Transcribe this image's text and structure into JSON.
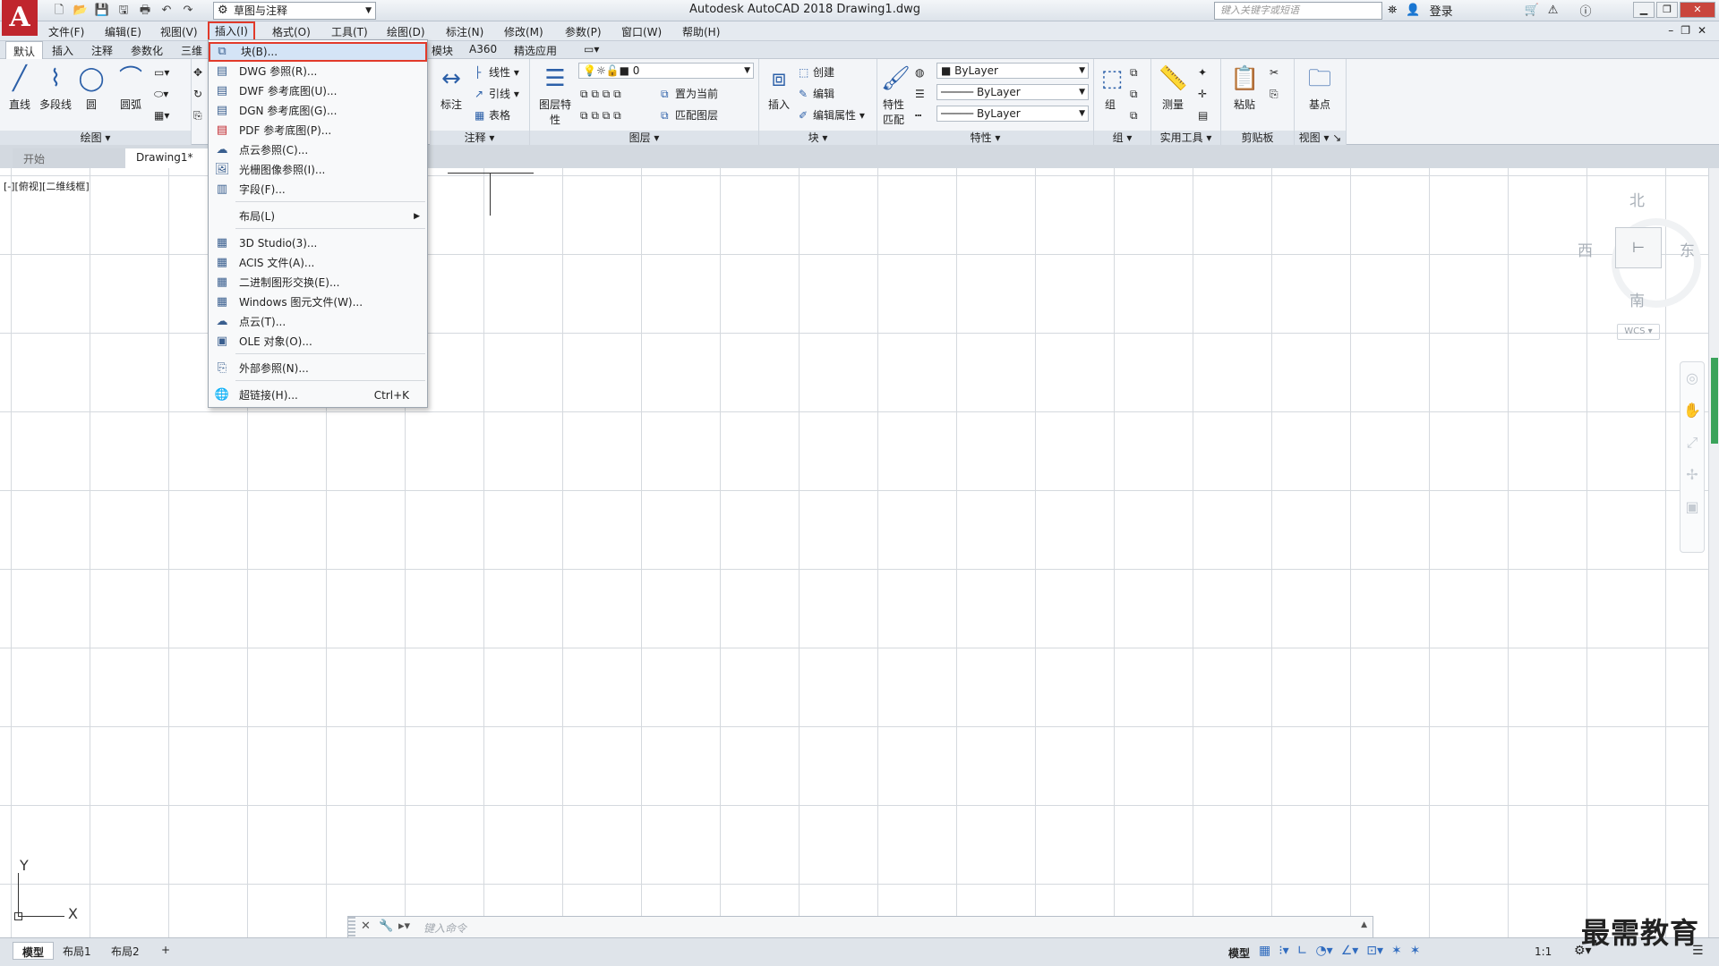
{
  "title_bar": {
    "app_logo": "A",
    "workspace": "草图与注释",
    "title": "Autodesk AutoCAD 2018    Drawing1.dwg",
    "search_placeholder": "键入关键字或短语",
    "login": "登录"
  },
  "menu": {
    "file": "文件(F)",
    "edit": "编辑(E)",
    "view": "视图(V)",
    "insert": "插入(I)",
    "format": "格式(O)",
    "tools": "工具(T)",
    "draw": "绘图(D)",
    "dimension": "标注(N)",
    "modify": "修改(M)",
    "parametric": "参数(P)",
    "window": "窗口(W)",
    "help": "帮助(H)"
  },
  "ribbon_tabs": {
    "default": "默认",
    "insert": "插入",
    "annotate": "注释",
    "parametric": "参数化",
    "three_d": "三维",
    "modules": "模块",
    "a360": "A360",
    "featured": "精选应用"
  },
  "ribbon": {
    "draw": {
      "title": "绘图",
      "line": "直线",
      "polyline": "多段线",
      "circle": "圆",
      "arc": "圆弧"
    },
    "annotation": {
      "title": "注释",
      "dimension": "标注",
      "linear": "线性",
      "leader": "引线",
      "table": "表格"
    },
    "layers": {
      "title": "图层",
      "layer_props": "图层特性",
      "layer_name": "0",
      "set_current": "置为当前",
      "match_layer": "匹配图层"
    },
    "block": {
      "title": "块",
      "insert": "插入",
      "create": "创建",
      "edit": "编辑",
      "edit_attr": "编辑属性"
    },
    "properties": {
      "title": "特性",
      "match": "特性匹配",
      "color": "ByLayer",
      "linetype": "ByLayer",
      "lineweight": "ByLayer"
    },
    "groups": {
      "title": "组",
      "group": "组"
    },
    "utilities": {
      "title": "实用工具",
      "measure": "测量"
    },
    "clipboard": {
      "title": "剪贴板",
      "paste": "粘贴"
    },
    "view": {
      "title": "视图",
      "base": "基点"
    }
  },
  "file_tabs": {
    "start": "开始",
    "drawing": "Drawing1*"
  },
  "viewport_label": "[-][俯视][二维线框]",
  "viewcube": {
    "north": "北",
    "south": "南",
    "east": "东",
    "west": "西",
    "wcs": "WCS"
  },
  "ucs": {
    "x": "X",
    "y": "Y"
  },
  "command_line": {
    "placeholder": "键入命令"
  },
  "layout_tabs": {
    "model": "模型",
    "layout1": "布局1",
    "layout2": "布局2"
  },
  "status": {
    "model": "模型",
    "scale": "1:1"
  },
  "watermark": "最需教育",
  "insert_menu": {
    "items": [
      {
        "label": "块(B)...",
        "icon": "block-icon"
      },
      {
        "label": "DWG 参照(R)...",
        "icon": "dwg-icon"
      },
      {
        "label": "DWF 参考底图(U)...",
        "icon": "dwf-icon"
      },
      {
        "label": "DGN 参考底图(G)...",
        "icon": "dgn-icon"
      },
      {
        "label": "PDF 参考底图(P)...",
        "icon": "pdf-icon"
      },
      {
        "label": "点云参照(C)...",
        "icon": "point-cloud-icon"
      },
      {
        "label": "光栅图像参照(I)...",
        "icon": "raster-image-icon"
      },
      {
        "label": "字段(F)...",
        "icon": "field-icon"
      },
      {
        "label": "布局(L)",
        "icon": ""
      },
      {
        "label": "3D Studio(3)...",
        "icon": "3ds-icon"
      },
      {
        "label": "ACIS 文件(A)...",
        "icon": "acis-icon"
      },
      {
        "label": "二进制图形交换(E)...",
        "icon": "dxb-icon"
      },
      {
        "label": "Windows 图元文件(W)...",
        "icon": "wmf-icon"
      },
      {
        "label": "点云(T)...",
        "icon": "point-cloud-attach-icon"
      },
      {
        "label": "OLE 对象(O)...",
        "icon": "ole-icon"
      },
      {
        "label": "外部参照(N)...",
        "icon": "xref-icon"
      },
      {
        "label": "超链接(H)...",
        "icon": "hyperlink-icon"
      }
    ],
    "hyperlink_shortcut": "Ctrl+K"
  }
}
